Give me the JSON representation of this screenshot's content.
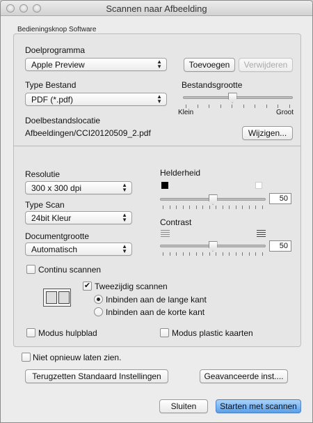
{
  "window": {
    "title": "Scannen naar Afbeelding"
  },
  "section": {
    "label": "Bedieningsknop Software"
  },
  "target_app": {
    "label": "Doelprogramma",
    "selected": "Apple Preview",
    "add_button": "Toevoegen",
    "remove_button": "Verwijderen"
  },
  "file_type": {
    "label": "Type Bestand",
    "selected": "PDF (*.pdf)"
  },
  "file_size": {
    "label": "Bestandsgrootte",
    "min_label": "Klein",
    "max_label": "Groot",
    "level": 0.45
  },
  "destination": {
    "label": "Doelbestandslocatie",
    "path": "Afbeeldingen/CCI20120509_2.pdf",
    "change_button": "Wijzigen..."
  },
  "resolution": {
    "label": "Resolutie",
    "selected": "300 x 300 dpi"
  },
  "scan_type": {
    "label": "Type Scan",
    "selected": "24bit Kleur"
  },
  "doc_size": {
    "label": "Documentgrootte",
    "selected": "Automatisch"
  },
  "brightness": {
    "label": "Helderheid",
    "value": "50",
    "level": 0.5
  },
  "contrast": {
    "label": "Contrast",
    "value": "50",
    "level": 0.5
  },
  "continuous_scan": {
    "label": "Continu scannen",
    "checked": false
  },
  "duplex": {
    "label": "Tweezijdig scannen",
    "checked": true,
    "long_edge": "Inbinden aan de lange kant",
    "short_edge": "Inbinden aan de korte kant",
    "selected": "long"
  },
  "carrier_sheet": {
    "label": "Modus hulpblad",
    "checked": false
  },
  "plastic_card": {
    "label": "Modus plastic kaarten",
    "checked": false
  },
  "dont_show": {
    "label": "Niet opnieuw laten zien.",
    "checked": false
  },
  "reset_button": "Terugzetten Standaard Instellingen",
  "advanced_button": "Geavanceerde inst....",
  "close_button": "Sluiten",
  "start_button": "Starten met scannen",
  "colors": {
    "accent": "#5a9fe8",
    "window_bg": "#ececec"
  }
}
